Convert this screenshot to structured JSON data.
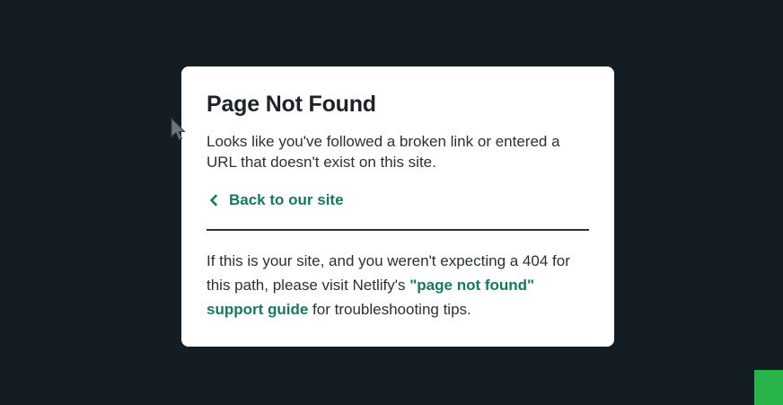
{
  "card": {
    "title": "Page Not Found",
    "description": "Looks like you've followed a broken link or entered a URL that doesn't exist on this site.",
    "back_link": {
      "label": "Back to our site",
      "icon": "chevron-left-icon"
    },
    "help": {
      "text_before": "If this is your site, and you weren't expecting a 404 for this path, please visit Netlify's ",
      "link_label": "\"page not found\" support guide",
      "text_after": " for troubleshooting tips."
    }
  },
  "colors": {
    "background": "#131d23",
    "card": "#ffffff",
    "heading": "#1e2328",
    "body_text": "#2b3036",
    "link": "#15795b",
    "corner_badge": "#28b34b"
  },
  "cursor": {
    "icon": "mouse-pointer-icon"
  }
}
